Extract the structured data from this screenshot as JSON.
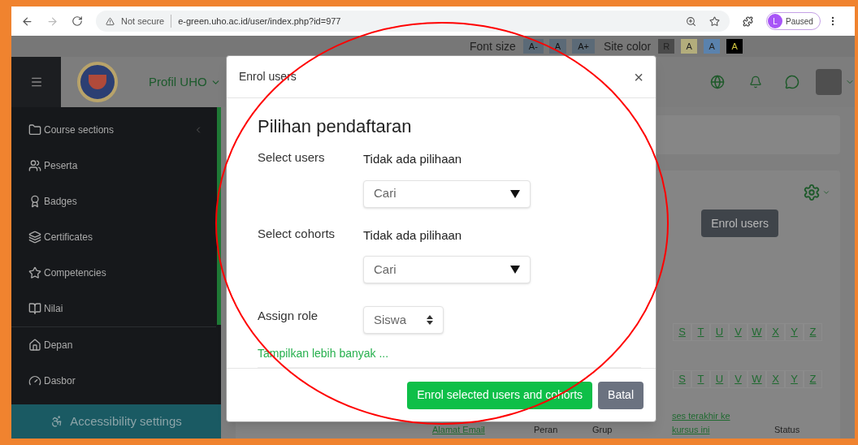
{
  "browser": {
    "security": "Not secure",
    "url": "e-green.uho.ac.id/user/index.php?id=977",
    "profile": {
      "initial": "L",
      "label": "Paused"
    }
  },
  "accessibility_bar": {
    "font_size_label": "Font size",
    "font_buttons": [
      "A-",
      "A",
      "A+"
    ],
    "site_color_label": "Site color",
    "color_buttons": [
      {
        "label": "R",
        "color": "#4a4a4a"
      },
      {
        "label": "A",
        "color": "#b3ad7c"
      },
      {
        "label": "A",
        "color": "#5a82ad"
      },
      {
        "label": "A",
        "color": "#000000"
      }
    ]
  },
  "navbar": {
    "brand": "Profil UHO"
  },
  "sidebar": {
    "sections": [
      [
        {
          "label": "Course sections",
          "collapsible": true
        },
        {
          "label": "Peserta",
          "collapsible": false
        },
        {
          "label": "Badges",
          "collapsible": false
        },
        {
          "label": "Certificates",
          "collapsible": false
        },
        {
          "label": "Competencies",
          "collapsible": false
        },
        {
          "label": "Nilai",
          "collapsible": false
        }
      ],
      [
        {
          "label": "Depan",
          "collapsible": false
        },
        {
          "label": "Dasbor",
          "collapsible": false
        }
      ]
    ],
    "footer_button": "Accessibility settings"
  },
  "page": {
    "enrol_button": "Enrol users",
    "letter_rows": [
      [
        "S",
        "T",
        "U",
        "V",
        "W",
        "X",
        "Y",
        "Z"
      ],
      [
        "S",
        "T",
        "U",
        "V",
        "W",
        "X",
        "Y",
        "Z"
      ]
    ],
    "table_columns": [
      "Alamat Email",
      "Peran",
      "Grup",
      "ses terakhir ke kursus ini",
      "Status"
    ]
  },
  "modal": {
    "title": "Enrol users",
    "close": "×",
    "heading": "Pilihan pendaftaran",
    "fields": [
      {
        "kind": "autocomplete",
        "label": "Select users",
        "note": "Tidak ada pilihaan",
        "placeholder": "Cari"
      },
      {
        "kind": "autocomplete",
        "label": "Select cohorts",
        "note": "Tidak ada pilihaan",
        "placeholder": "Cari"
      },
      {
        "kind": "select",
        "label": "Assign role",
        "value": "Siswa"
      }
    ],
    "show_more": "Tampilkan lebih banyak ...",
    "buttons": [
      {
        "label": "Enrol selected users and cohorts",
        "kind": "primary"
      },
      {
        "label": "Batal",
        "kind": "secondary"
      }
    ]
  }
}
